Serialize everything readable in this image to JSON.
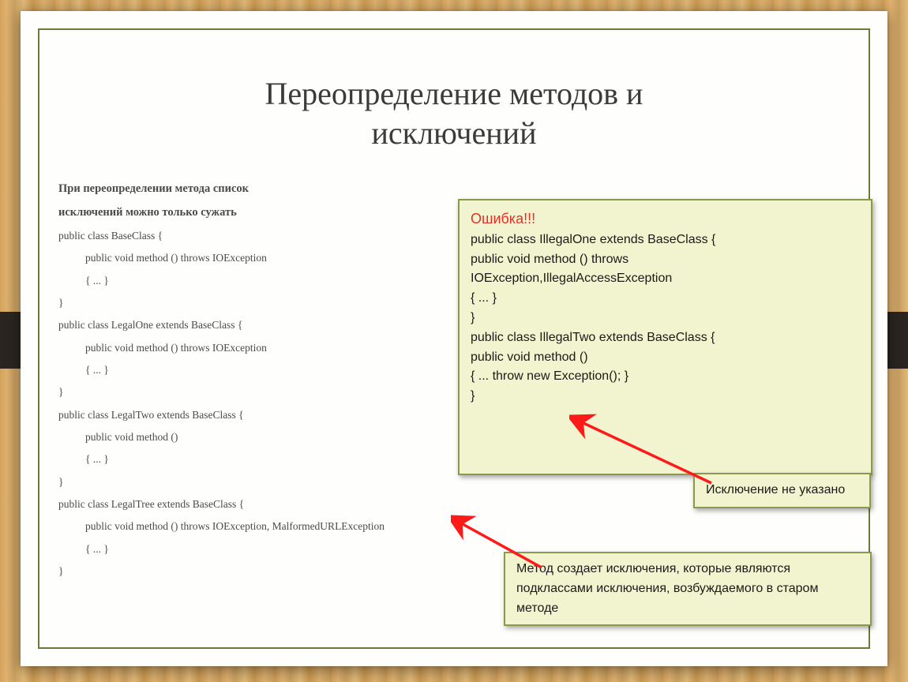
{
  "title_line1": "Переопределение методов и",
  "title_line2": "исключений",
  "left": {
    "bold1": "При переопределении метода список",
    "bold2": "исключений можно только сужать",
    "l01": "public class BaseClass {",
    "l02": "public void method () throws IOException",
    "l03": "{   ...   }",
    "l04": "}",
    "l05": "public class LegalOne extends BaseClass  {",
    "l06": "public void method () throws IOException",
    "l07": "{     ...   }",
    "l08": "}",
    "l09": "public class LegalTwo extends BaseClass  {",
    "l10": "public void method ()",
    "l11": "{     ...   }",
    "l12": "}",
    "l13": "public class LegalTree extends BaseClass  {",
    "l14": "public void method () throws IOException, MalformedURLException",
    "l15": "{     ...   }",
    "l16": "}"
  },
  "main_callout": {
    "err": "Ошибка!!!",
    "m1": "public  class  IllegalOne  extends  BaseClass  {",
    "m2": "         public  void  method ()  throws",
    "m3": "IOException,IllegalAccessException",
    "m4": "{       ...     }",
    "m5": "}",
    "m6": "public  class  IllegalTwo  extends  BaseClass  {",
    "m7": "public  void  method ()",
    "m8": "{       ...       throw  new  Exception();    }",
    "m9": "}"
  },
  "note1": "Исключение не указано",
  "note2": "Метод создает исключения,  которые являются подклассами исключения, возбуждаемого в старом методе"
}
